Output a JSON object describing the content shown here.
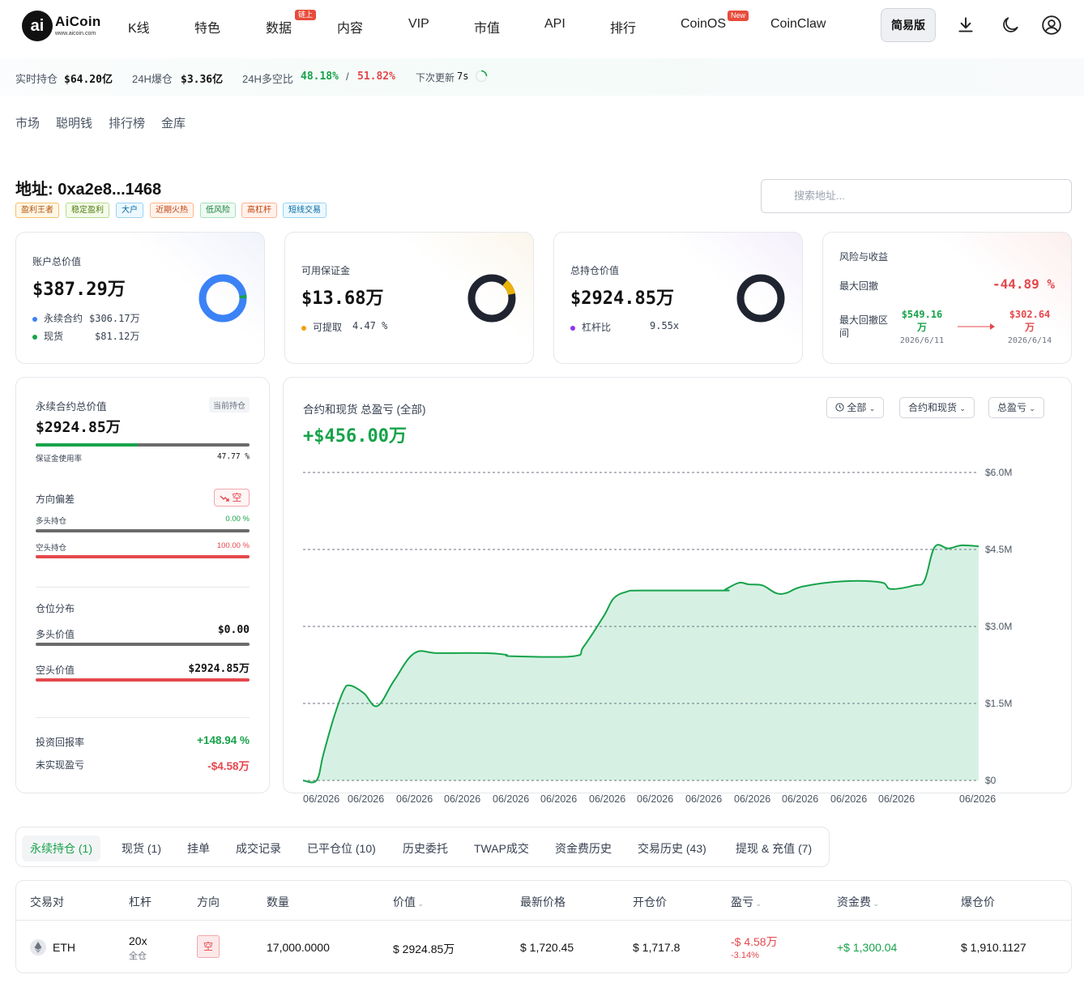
{
  "brand": {
    "logo_mark": "ai",
    "name": "AiCoin",
    "url_text": "www.aicoin.com"
  },
  "nav": {
    "items": [
      {
        "label": "K线"
      },
      {
        "label": "特色"
      },
      {
        "label": "数据",
        "badge": "链上"
      },
      {
        "label": "内容"
      },
      {
        "label": "VIP"
      },
      {
        "label": "市值"
      },
      {
        "label": "API"
      },
      {
        "label": "排行"
      },
      {
        "label": "CoinOS",
        "badge": "New"
      },
      {
        "label": "CoinClaw"
      }
    ],
    "simple_mode": "简易版",
    "icons": [
      "download-icon",
      "moon-icon",
      "user-icon"
    ]
  },
  "stats": {
    "holding_label": "实时持仓",
    "holding_value": "$64.20亿",
    "liq_label": "24H爆仓",
    "liq_value": "$3.36亿",
    "ratio_label": "24H多空比",
    "long_ratio": "48.18%",
    "sep": "/",
    "short_ratio": "51.82%",
    "next_update_label": "下次更新",
    "next_update_value": "7s"
  },
  "subtabs": [
    "市场",
    "聪明钱",
    "排行榜",
    "金库"
  ],
  "address": {
    "title": "地址: 0xa2e8...1468",
    "tags": [
      "盈利王者",
      "稳定盈利",
      "大户",
      "近期火热",
      "低风险",
      "高杠杆",
      "短线交易"
    ],
    "search_placeholder": "搜索地址..."
  },
  "cards": {
    "account": {
      "label": "账户总价值",
      "value": "$387.29万",
      "perp_label": "永续合约",
      "perp_value": "$306.17万",
      "spot_label": "现货",
      "spot_value": "$81.12万",
      "perp_share": 0.79
    },
    "margin": {
      "label": "可用保证金",
      "value": "$13.68万",
      "withdrawable_label": "可提取",
      "withdrawable_value": "4.47 %",
      "withdrawable_share": 0.0447
    },
    "position": {
      "label": "总持仓价值",
      "value": "$2924.85万",
      "leverage_label": "杠杆比",
      "leverage_value": "9.55x"
    },
    "risk": {
      "label": "风险与收益",
      "max_dd_label": "最大回撤",
      "max_dd_value": "-44.89 %",
      "range_label": "最大回撤区间",
      "from_value": "$549.16万",
      "from_date": "2026/6/11",
      "to_value": "$302.64万",
      "to_date": "2026/6/14"
    }
  },
  "perp_panel": {
    "title": "永续合约总价值",
    "badge": "当前持仓",
    "value": "$2924.85万",
    "margin_usage_label": "保证金使用率",
    "margin_usage_value": "47.77 %",
    "margin_usage": 0.4777,
    "direction_label": "方向偏差",
    "direction_badge": "空",
    "long_label": "多头持仓",
    "long_value": "0.00 %",
    "short_label": "空头持仓",
    "short_value": "100.00 %",
    "dist_label": "仓位分布",
    "long_val_label": "多头价值",
    "long_val": "$0.00",
    "short_val_label": "空头价值",
    "short_val": "$2924.85万",
    "roi_label": "投资回报率",
    "roi_value": "+148.94 %",
    "upnl_label": "未实现盈亏",
    "upnl_value": "-$4.58万"
  },
  "chart_panel": {
    "title": "合约和现货 总盈亏 (全部)",
    "value": "+$456.00万",
    "filters": [
      "全部",
      "合约和现货",
      "总盈亏"
    ],
    "accent": "#16a34a",
    "fill": "#d6f1e4"
  },
  "chart_data": {
    "type": "area",
    "yticks": [
      "$6.0M",
      "$4.5M",
      "$3.0M",
      "$1.5M",
      "$0"
    ],
    "ylim": [
      0,
      6.0
    ],
    "xticks": [
      "06/2026",
      "06/2026",
      "06/2026",
      "06/2026",
      "06/2026",
      "06/2026",
      "06/2026",
      "06/2026",
      "06/2026",
      "06/2026",
      "06/2026",
      "06/2026",
      "06/2026",
      "06/2026"
    ],
    "grid": true,
    "points": [
      [
        0,
        0.0
      ],
      [
        0.02,
        0.0
      ],
      [
        0.03,
        0.5
      ],
      [
        0.045,
        1.2
      ],
      [
        0.06,
        1.75
      ],
      [
        0.07,
        1.85
      ],
      [
        0.09,
        1.7
      ],
      [
        0.11,
        1.45
      ],
      [
        0.135,
        1.95
      ],
      [
        0.165,
        2.48
      ],
      [
        0.2,
        2.48
      ],
      [
        0.27,
        2.48
      ],
      [
        0.3,
        2.45
      ],
      [
        0.31,
        2.42
      ],
      [
        0.4,
        2.42
      ],
      [
        0.415,
        2.6
      ],
      [
        0.445,
        3.2
      ],
      [
        0.46,
        3.55
      ],
      [
        0.48,
        3.68
      ],
      [
        0.5,
        3.7
      ],
      [
        0.62,
        3.7
      ],
      [
        0.625,
        3.72
      ],
      [
        0.645,
        3.85
      ],
      [
        0.66,
        3.82
      ],
      [
        0.68,
        3.8
      ],
      [
        0.7,
        3.65
      ],
      [
        0.715,
        3.65
      ],
      [
        0.74,
        3.78
      ],
      [
        0.8,
        3.88
      ],
      [
        0.855,
        3.86
      ],
      [
        0.87,
        3.73
      ],
      [
        0.905,
        3.8
      ],
      [
        0.92,
        3.9
      ],
      [
        0.935,
        4.55
      ],
      [
        0.955,
        4.52
      ],
      [
        0.975,
        4.58
      ],
      [
        1.0,
        4.56
      ]
    ]
  },
  "bottom_tabs": [
    {
      "label": "永续持仓 (1)",
      "active": true
    },
    {
      "label": "现货 (1)"
    },
    {
      "label": "挂单"
    },
    {
      "label": "成交记录"
    },
    {
      "label": "已平仓位 (10)"
    },
    {
      "label": "历史委托"
    },
    {
      "label": "TWAP成交"
    },
    {
      "label": "资金费历史"
    },
    {
      "label": "交易历史 (43)"
    },
    {
      "label": "提现 & 充值 (7)"
    }
  ],
  "table": {
    "headers": [
      "交易对",
      "杠杆",
      "方向",
      "数量",
      "价值",
      "最新价格",
      "开仓价",
      "盈亏",
      "资金费",
      "爆仓价"
    ],
    "row": {
      "pair": "ETH",
      "leverage": "20x",
      "margin_mode": "全仓",
      "side": "空",
      "qty": "17,000.0000",
      "value": "$ 2924.85万",
      "last_price": "$ 1,720.45",
      "entry": "$ 1,717.8",
      "pnl": "-$ 4.58万",
      "pnl_pct": "-3.14%",
      "funding": "+$ 1,300.04",
      "liq_price": "$ 1,910.1127"
    }
  },
  "colors": {
    "green": "#16a34a",
    "red": "#e5484d",
    "dark": "#1f2430",
    "blue": "#3b82f6"
  }
}
